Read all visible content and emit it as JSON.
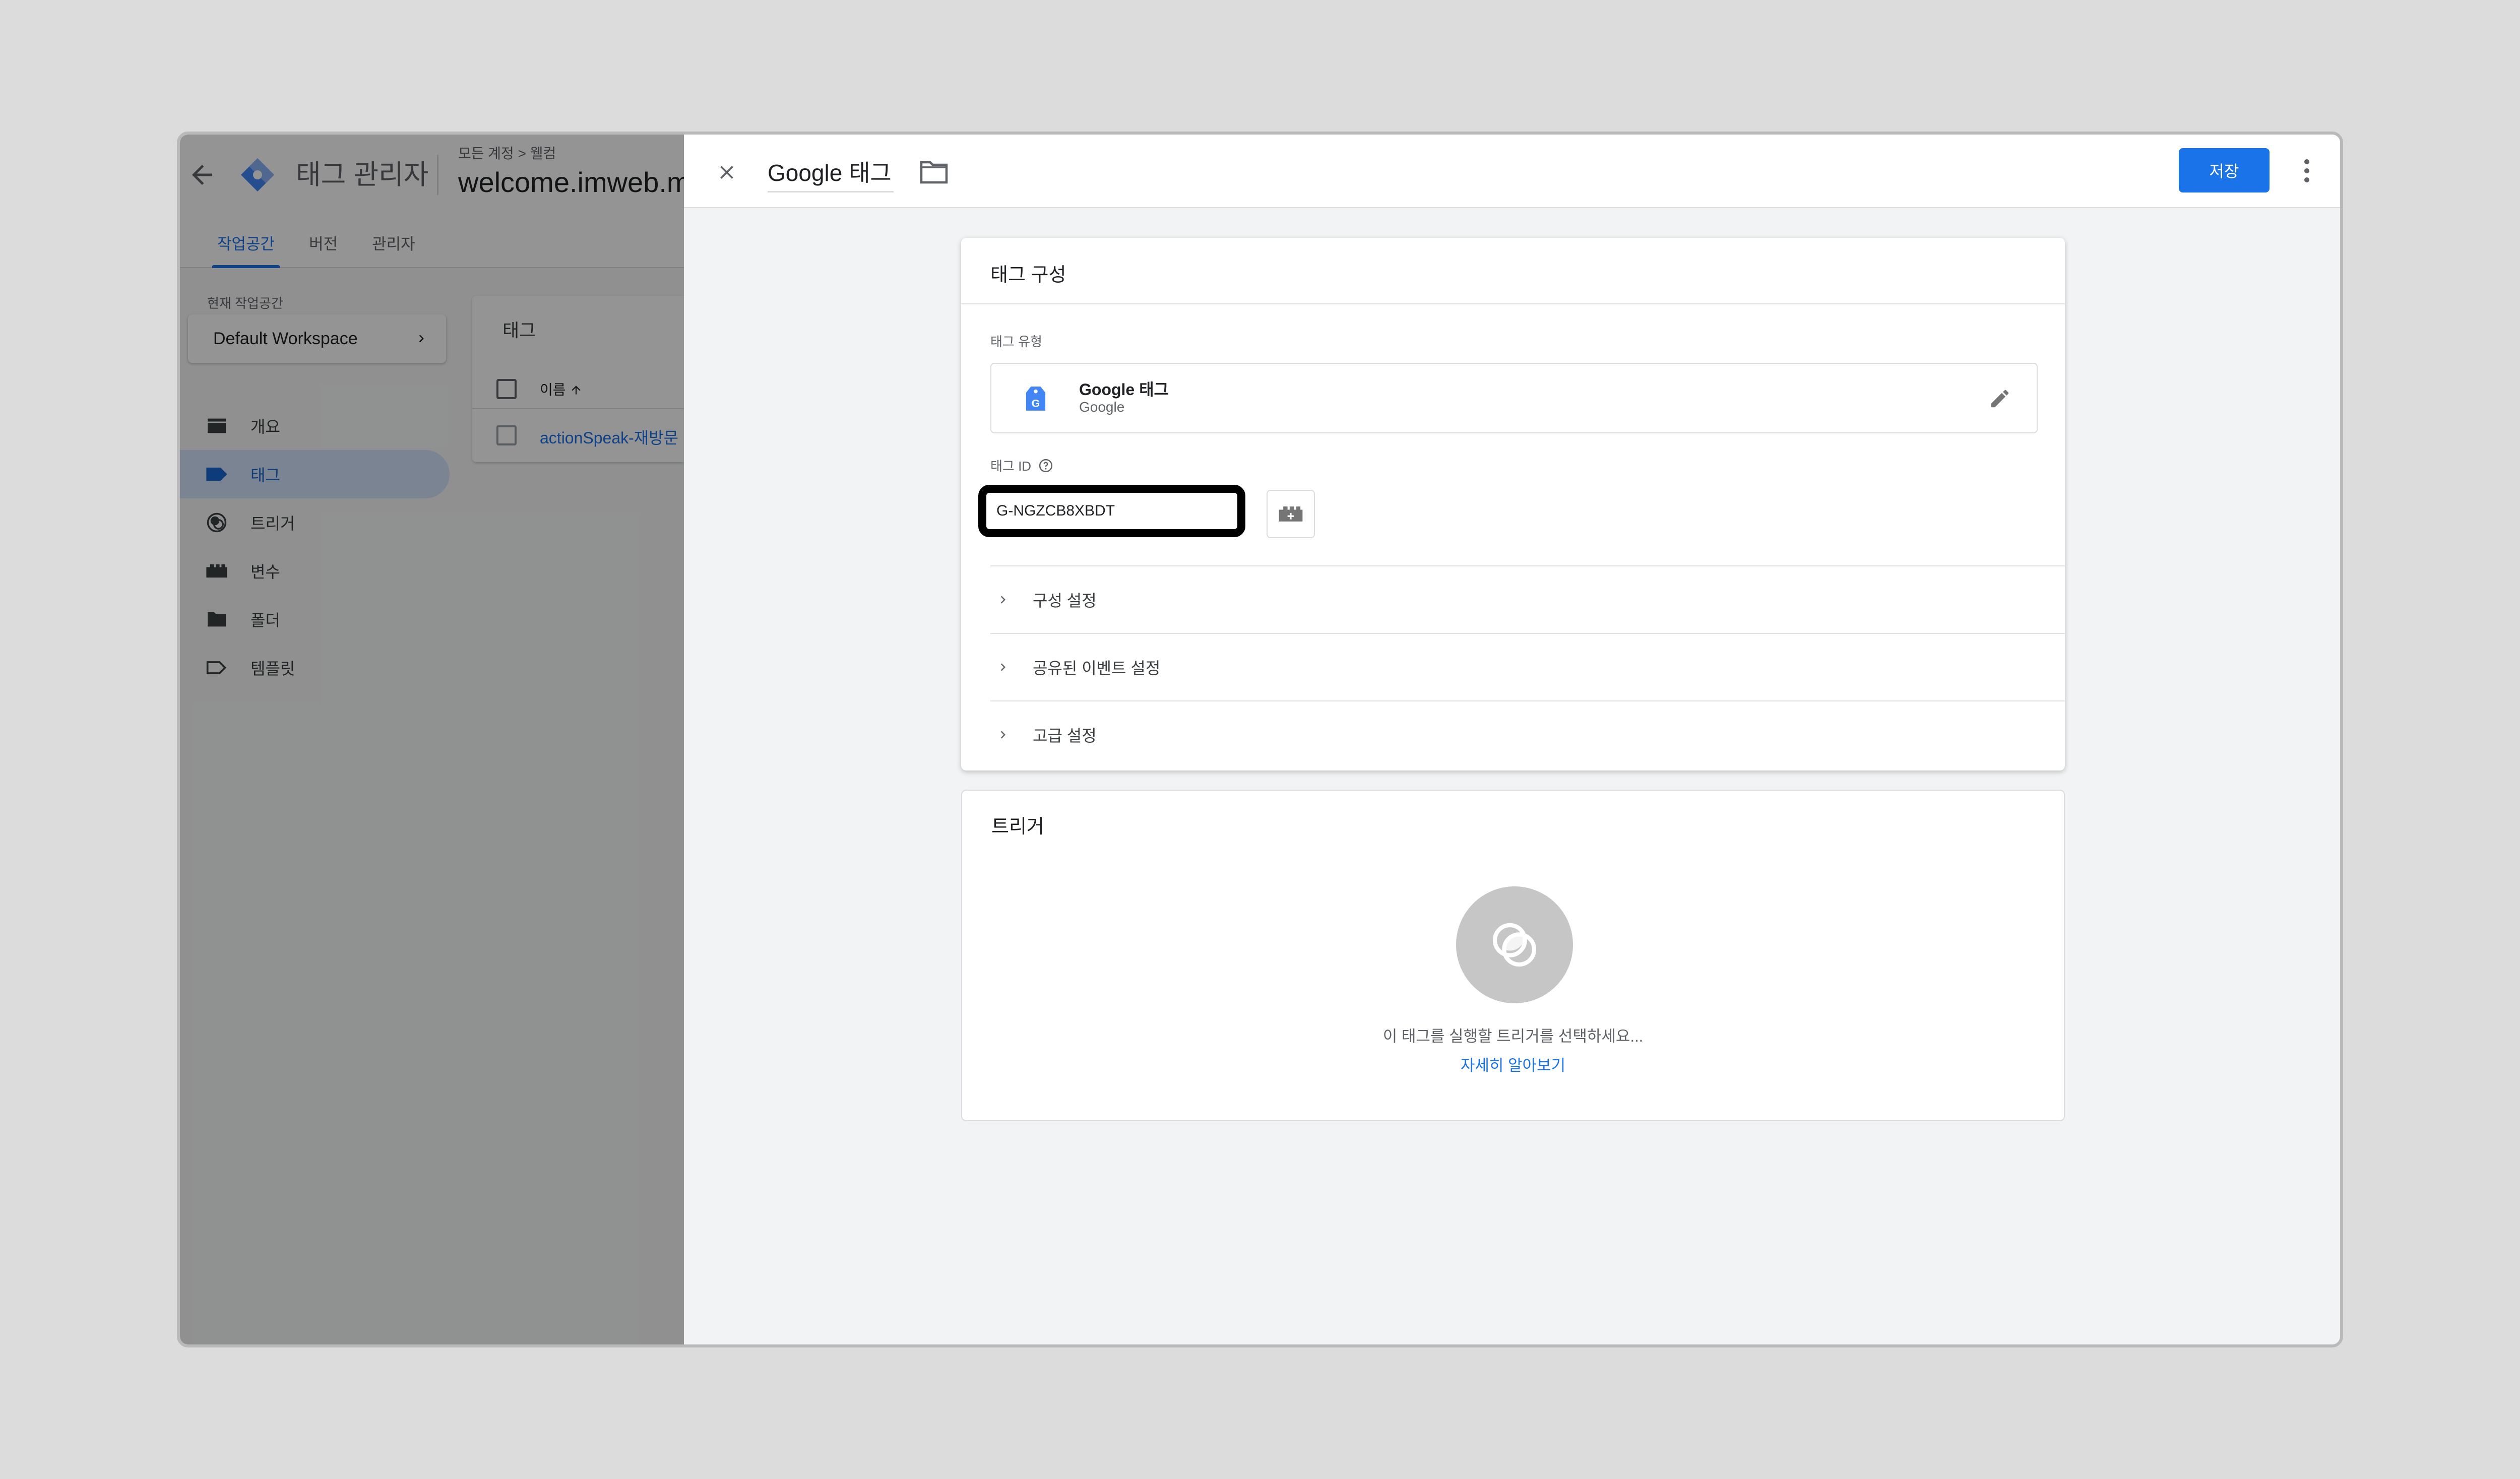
{
  "background_app": {
    "title": "태그 관리자",
    "breadcrumb": "모든 계정 > 웰컴",
    "container_name": "welcome.imweb.me",
    "tabs": [
      {
        "label": "작업공간",
        "active": true
      },
      {
        "label": "버전",
        "active": false
      },
      {
        "label": "관리자",
        "active": false
      }
    ],
    "workspace_label": "현재 작업공간",
    "workspace_name": "Default Workspace",
    "nav": [
      {
        "label": "개요",
        "icon": "overview-icon",
        "active": false
      },
      {
        "label": "태그",
        "icon": "tag-icon",
        "active": true
      },
      {
        "label": "트리거",
        "icon": "trigger-icon",
        "active": false
      },
      {
        "label": "변수",
        "icon": "variable-icon",
        "active": false
      },
      {
        "label": "폴더",
        "icon": "folder-icon",
        "active": false
      },
      {
        "label": "템플릿",
        "icon": "template-icon",
        "active": false
      }
    ],
    "tags_list": {
      "title": "태그",
      "column_name": "이름",
      "rows": [
        {
          "name": "actionSpeak-재방문"
        }
      ]
    }
  },
  "editor": {
    "tag_name": "Google 태그",
    "save_label": "저장",
    "config": {
      "title": "태그 구성",
      "tag_type_label": "태그 유형",
      "tag_type_name": "Google 태그",
      "tag_type_vendor": "Google",
      "tag_id_label": "태그 ID",
      "tag_id_value": "G-NGZCB8XBDT",
      "sections": [
        "구성 설정",
        "공유된 이벤트 설정",
        "고급 설정"
      ]
    },
    "trigger": {
      "title": "트리거",
      "hint": "이 태그를 실행할 트리거를 선택하세요...",
      "learn_more": "자세히 알아보기"
    }
  },
  "colors": {
    "accent": "#1a73e8",
    "highlight_border": "#000000"
  }
}
